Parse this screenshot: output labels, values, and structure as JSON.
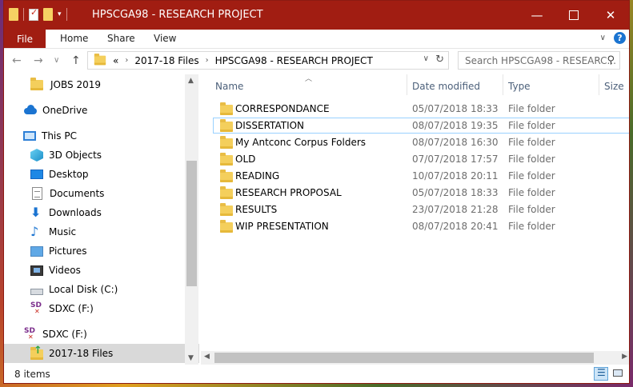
{
  "window": {
    "title": "HPSCGA98 - RESEARCH PROJECT",
    "accent_color": "#a11d12"
  },
  "ribbon": {
    "file": "File",
    "home": "Home",
    "share": "Share",
    "view": "View"
  },
  "address": {
    "overflow": "«",
    "crumbs": [
      "2017-18 Files",
      "HPSCGA98 - RESEARCH PROJECT"
    ],
    "search_placeholder": "Search HPSCGA98 - RESEARC..."
  },
  "nav": {
    "items": [
      {
        "label": "JOBS 2019",
        "icon": "folder-icon"
      },
      {
        "label": "OneDrive",
        "icon": "onedrive-icon"
      },
      {
        "label": "This PC",
        "icon": "computer-icon"
      },
      {
        "label": "3D Objects",
        "icon": "3d-objects-icon"
      },
      {
        "label": "Desktop",
        "icon": "desktop-icon"
      },
      {
        "label": "Documents",
        "icon": "documents-icon"
      },
      {
        "label": "Downloads",
        "icon": "downloads-icon"
      },
      {
        "label": "Music",
        "icon": "music-icon"
      },
      {
        "label": "Pictures",
        "icon": "pictures-icon"
      },
      {
        "label": "Videos",
        "icon": "videos-icon"
      },
      {
        "label": "Local Disk (C:)",
        "icon": "disk-icon"
      },
      {
        "label": "SDXC (F:)",
        "icon": "sd-card-icon"
      },
      {
        "label": "SDXC (F:)",
        "icon": "sd-card-icon"
      },
      {
        "label": "2017-18 Files",
        "icon": "folder-icon"
      }
    ]
  },
  "columns": {
    "name": "Name",
    "date": "Date modified",
    "type": "Type",
    "size": "Size"
  },
  "files": [
    {
      "name": "CORRESPONDANCE",
      "date": "05/07/2018 18:33",
      "type": "File folder"
    },
    {
      "name": "DISSERTATION",
      "date": "08/07/2018 19:35",
      "type": "File folder"
    },
    {
      "name": "My Antconc Corpus Folders",
      "date": "08/07/2018 16:30",
      "type": "File folder"
    },
    {
      "name": "OLD",
      "date": "07/07/2018 17:57",
      "type": "File folder"
    },
    {
      "name": "READING",
      "date": "10/07/2018 20:11",
      "type": "File folder"
    },
    {
      "name": "RESEARCH PROPOSAL",
      "date": "05/07/2018 18:33",
      "type": "File folder"
    },
    {
      "name": "RESULTS",
      "date": "23/07/2018 21:28",
      "type": "File folder"
    },
    {
      "name": "WIP PRESENTATION",
      "date": "08/07/2018 20:41",
      "type": "File folder"
    }
  ],
  "status": {
    "items": "8 items"
  }
}
